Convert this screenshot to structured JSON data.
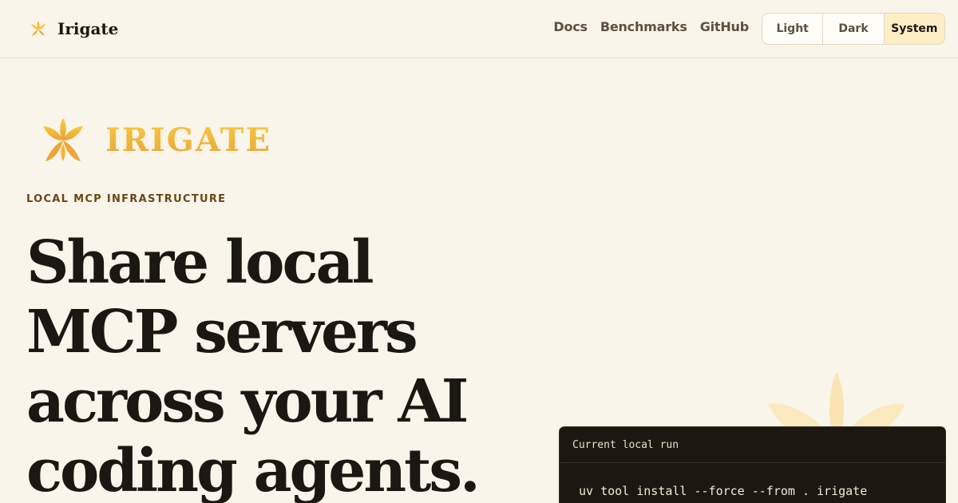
{
  "header": {
    "brand_name": "Irigate",
    "nav": [
      {
        "label": "Docs"
      },
      {
        "label": "Benchmarks"
      },
      {
        "label": "GitHub"
      }
    ],
    "theme_options": [
      {
        "label": "Light"
      },
      {
        "label": "Dark"
      },
      {
        "label": "System",
        "selected": true
      }
    ]
  },
  "hero": {
    "wordmark": "IRIGATE",
    "eyebrow": "LOCAL MCP INFRASTRUCTURE",
    "headline_lines": [
      "Share local",
      "MCP servers",
      "across your AI",
      "coding agents."
    ]
  },
  "terminal": {
    "title": "Current local run",
    "command": "uv tool install --force --from . irigate"
  },
  "colors": {
    "background": "#faf5eb",
    "accent_gold": "#f2b234",
    "selected_theme_bg": "#fdeec5",
    "terminal_bg": "#1c1710"
  },
  "icons": {
    "brand": "lotus-icon",
    "watermark": "lotus-watermark-icon"
  }
}
